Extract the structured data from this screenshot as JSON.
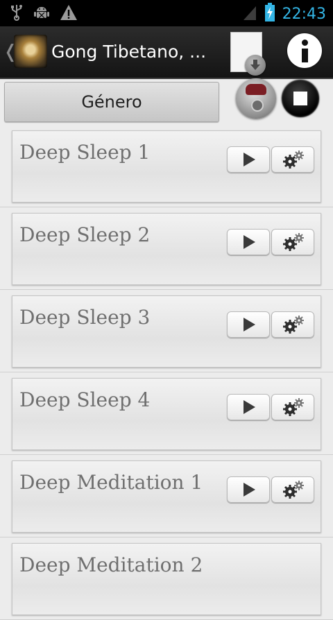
{
  "status_bar": {
    "time": "22:43",
    "left_icons": [
      "usb-icon",
      "android-debug-icon",
      "warning-icon"
    ],
    "right_icons": [
      "signal-icon",
      "battery-charging-icon"
    ]
  },
  "action_bar": {
    "up_glyph": "❬",
    "title": "Gong Tibetano, ...",
    "icons": [
      "app-icon",
      "download-icon",
      "info-icon"
    ]
  },
  "toolbar": {
    "genre_label": "Género",
    "icons": [
      "radio-icon",
      "stop-icon"
    ]
  },
  "tracks": [
    {
      "title": "Deep Sleep 1"
    },
    {
      "title": "Deep Sleep 2"
    },
    {
      "title": "Deep Sleep 3"
    },
    {
      "title": "Deep Sleep 4"
    },
    {
      "title": "Deep Meditation 1"
    },
    {
      "title": "Deep Meditation 2"
    }
  ],
  "colors": {
    "status_accent": "#33b5e5",
    "action_bar_bg": "#1e1e1e",
    "background": "#ececec",
    "track_text": "#6f6f6f"
  }
}
